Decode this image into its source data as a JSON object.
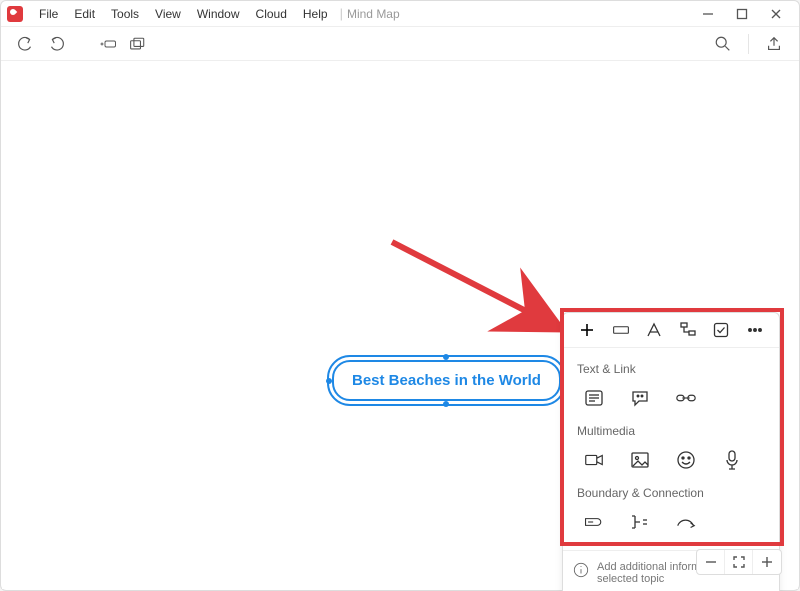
{
  "menu": {
    "items": [
      "File",
      "Edit",
      "Tools",
      "View",
      "Window",
      "Cloud",
      "Help"
    ],
    "doc_title": "Mind Map"
  },
  "node": {
    "text": "Best Beaches in the World"
  },
  "panel": {
    "tabs": [
      "plus",
      "shape",
      "text",
      "structure",
      "task",
      "more"
    ],
    "active_tab_index": 0,
    "sections": {
      "text_link_label": "Text & Link",
      "multimedia_label": "Multimedia",
      "boundary_label": "Boundary & Connection"
    },
    "hint": "Add additional information to the selected topic"
  },
  "zoom": {
    "minus": "−",
    "plus": "+"
  }
}
